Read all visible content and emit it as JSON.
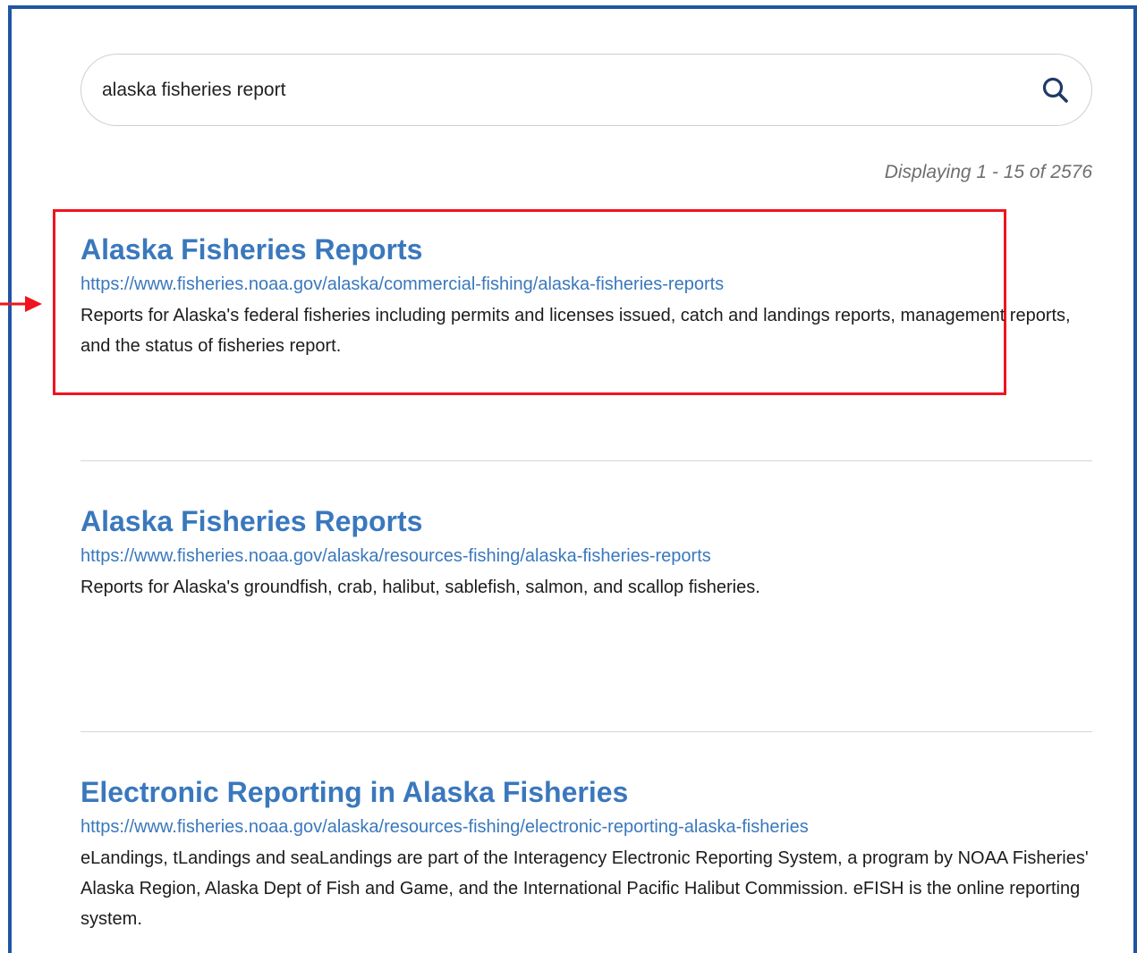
{
  "search": {
    "query": "alaska fisheries report",
    "icon": "search-icon"
  },
  "result_count": "Displaying 1 - 15 of 2576",
  "annotation": {
    "highlight_color": "#f0141e",
    "arrow_color": "#f0141e"
  },
  "colors": {
    "frame_border": "#1f56a3",
    "link": "#3a78bd"
  },
  "results": [
    {
      "title": "Alaska Fisheries Reports",
      "url": "https://www.fisheries.noaa.gov/alaska/commercial-fishing/alaska-fisheries-reports",
      "description": "Reports for Alaska's federal fisheries including permits and licenses issued, catch and landings reports, management reports, and the status of fisheries report."
    },
    {
      "title": "Alaska Fisheries Reports",
      "url": "https://www.fisheries.noaa.gov/alaska/resources-fishing/alaska-fisheries-reports",
      "description": "Reports for Alaska's groundfish, crab, halibut, sablefish, salmon, and scallop fisheries."
    },
    {
      "title": "Electronic Reporting in Alaska Fisheries",
      "url": "https://www.fisheries.noaa.gov/alaska/resources-fishing/electronic-reporting-alaska-fisheries",
      "description": "eLandings, tLandings and seaLandings are part of the Interagency Electronic Reporting System, a program by NOAA Fisheries' Alaska Region, Alaska Dept of Fish and Game, and the International Pacific Halibut Commission. eFISH is the online reporting system."
    }
  ]
}
